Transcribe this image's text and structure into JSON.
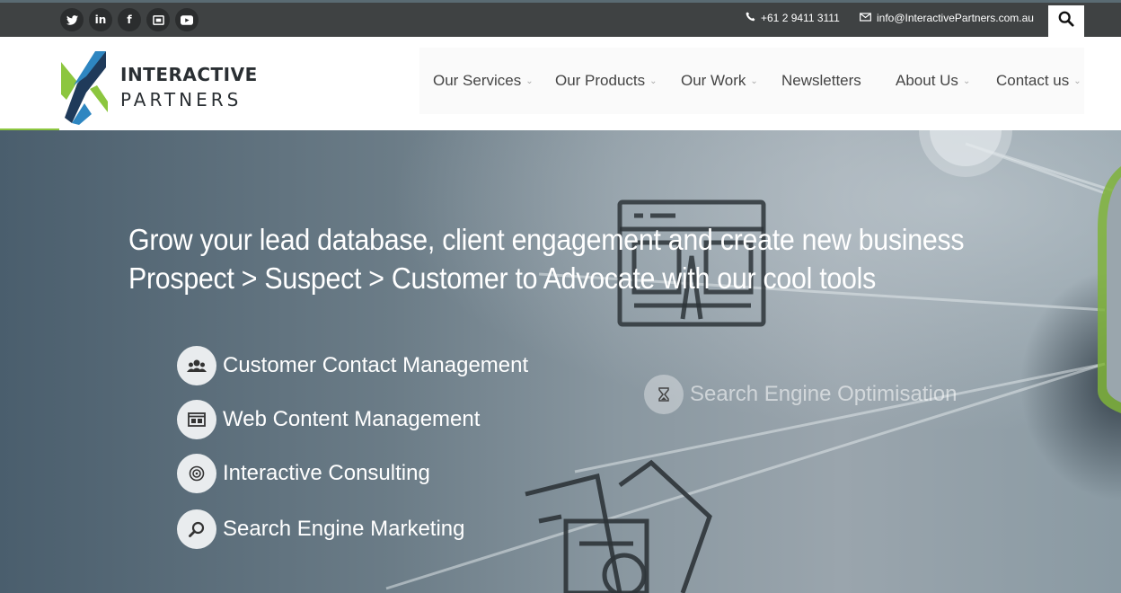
{
  "topbar": {
    "social": [
      {
        "name": "twitter",
        "glyph": "t"
      },
      {
        "name": "linkedin",
        "glyph": "in"
      },
      {
        "name": "facebook",
        "glyph": "f"
      },
      {
        "name": "meetup",
        "glyph": "m"
      },
      {
        "name": "youtube",
        "glyph": "▶"
      }
    ],
    "phone": "+61 2 9411 3111",
    "email": "info@InteractivePartners.com.au"
  },
  "brand": {
    "line1": "INTERACTIVE",
    "line2": "PARTNERS",
    "colors": {
      "blue": "#2e86c1",
      "green": "#8cc63f",
      "navy": "#1f3a5a"
    }
  },
  "nav": {
    "items": [
      {
        "label": "Our Services",
        "has_dropdown": true
      },
      {
        "label": "Our Products",
        "has_dropdown": true
      },
      {
        "label": "Our Work",
        "has_dropdown": true
      },
      {
        "label": "Newsletters",
        "has_dropdown": false
      },
      {
        "label": "About Us",
        "has_dropdown": true
      },
      {
        "label": "Contact us",
        "has_dropdown": true
      }
    ]
  },
  "hero": {
    "headline_line1": "Grow your lead database, client engagement and create new business",
    "headline_line2": "Prospect > Suspect > Customer to Advocate with our cool tools",
    "services": [
      {
        "label": "Customer Contact Management",
        "icon": "people-icon"
      },
      {
        "label": "Web Content Management",
        "icon": "browser-icon"
      },
      {
        "label": "Interactive Consulting",
        "icon": "target-icon"
      },
      {
        "label": "Search Engine Marketing",
        "icon": "magnifier-icon"
      }
    ],
    "faded_service": {
      "label": "Search Engine Optimisation",
      "icon": "hourglass-icon"
    }
  }
}
